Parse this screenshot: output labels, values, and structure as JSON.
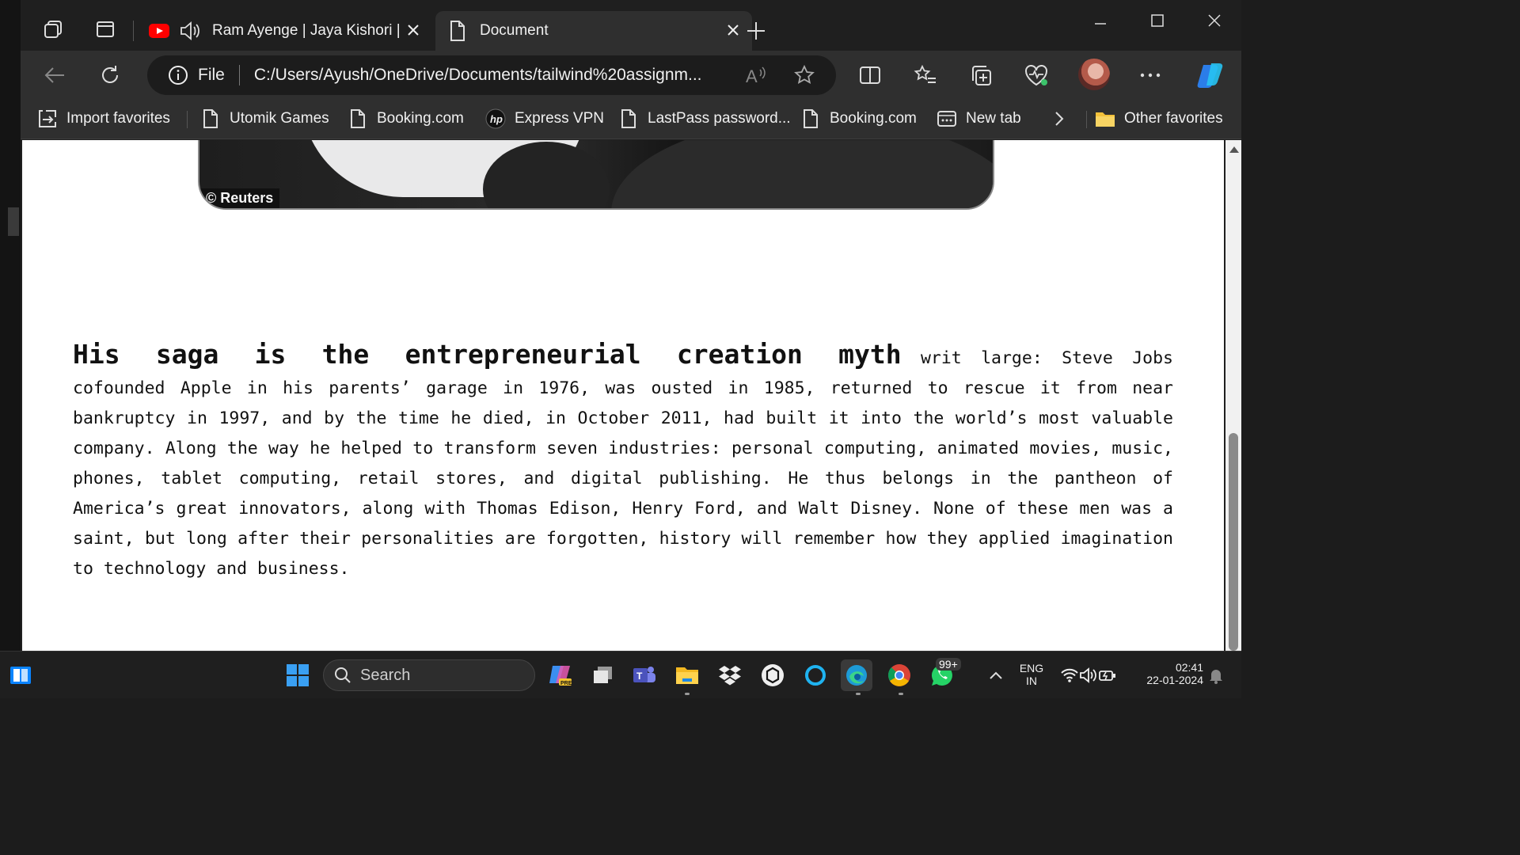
{
  "tabs": {
    "inactive_title": "Ram Ayenge | Jaya Kishori |",
    "active_title": "Document"
  },
  "address_bar": {
    "scheme_label": "File",
    "url": "C:/Users/Ayush/OneDrive/Documents/tailwind%20assignm..."
  },
  "favorites": [
    {
      "label": "Import favorites",
      "icon": "import-icon"
    },
    {
      "label": "Utomik Games",
      "icon": "page-icon"
    },
    {
      "label": "Booking.com",
      "icon": "page-icon"
    },
    {
      "label": "Express VPN",
      "icon": "hp-icon"
    },
    {
      "label": "LastPass password...",
      "icon": "page-icon"
    },
    {
      "label": "Booking.com",
      "icon": "page-icon"
    },
    {
      "label": "New tab",
      "icon": "newtab-icon"
    },
    {
      "label": "Other favorites",
      "icon": "folder-icon"
    }
  ],
  "photo": {
    "credit": "© Reuters"
  },
  "article": {
    "lead": "His saga is the entrepreneurial creation myth",
    "body": " writ large: Steve Jobs cofounded Apple in his parents’ garage in 1976, was ousted in 1985, returned to rescue it from near bankruptcy in 1997, and by the time he died, in October 2011, had built it into the world’s most valuable company. Along the way he helped to transform seven industries: personal computing, animated movies, music, phones, tablet computing, retail stores, and digital publishing. He thus belongs in the pantheon of America’s great innovators, along with Thomas Edison, Henry Ford, and Walt Disney. None of these men was a saint, but long after their personalities are forgotten, history will remember how they applied imagination to technology and business."
  },
  "taskbar": {
    "search_placeholder": "Search",
    "whatsapp_badge": "99+",
    "lang_top": "ENG",
    "lang_bottom": "IN",
    "time": "02:41",
    "date": "22-01-2024"
  },
  "colors": {
    "tab_strip": "#1f1f1f",
    "toolbar": "#2f2f2f",
    "page_bg": "#ffffff",
    "youtube_red": "#ff0000"
  }
}
